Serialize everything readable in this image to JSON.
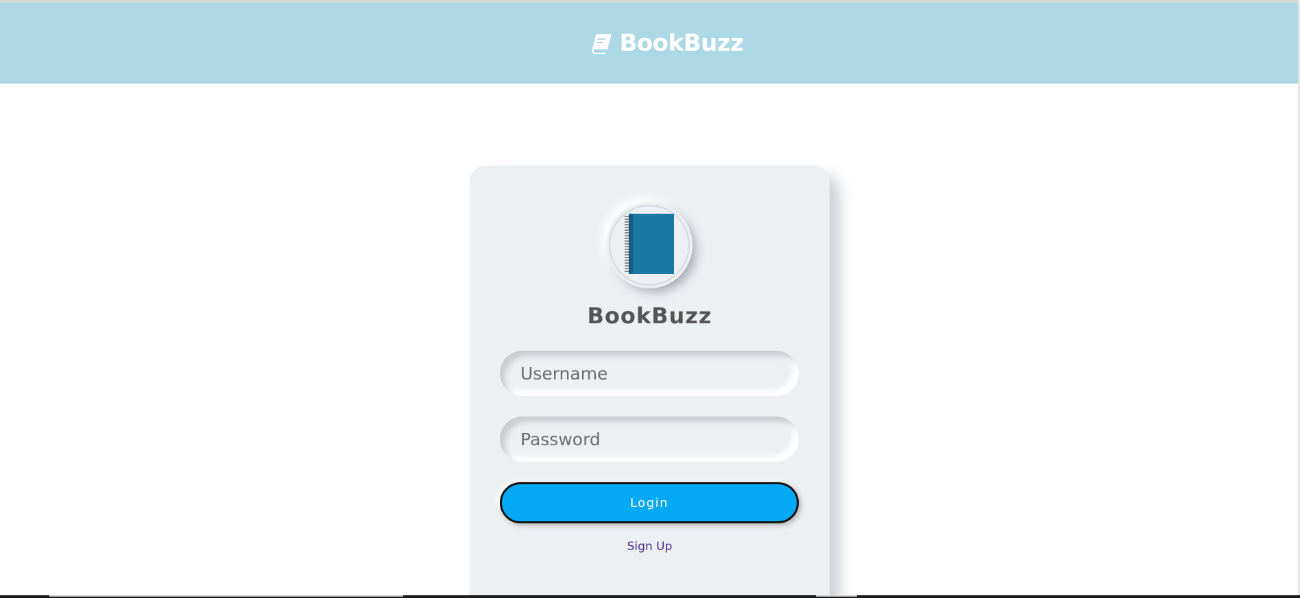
{
  "navbar": {
    "brand_text": "BookBuzz",
    "brand_icon": "book-icon",
    "background_color": "#add8e6"
  },
  "login_card": {
    "avatar_icon": "notebook-icon",
    "title": "BookBuzz",
    "username_placeholder": "Username",
    "password_placeholder": "Password",
    "login_label": "Login",
    "signup_label": "Sign Up"
  },
  "colors": {
    "card_background": "#ecf0f3",
    "login_button": "#03a9f4",
    "notebook_cover": "#1b77a4",
    "signup_link": "#4b2a8a"
  }
}
